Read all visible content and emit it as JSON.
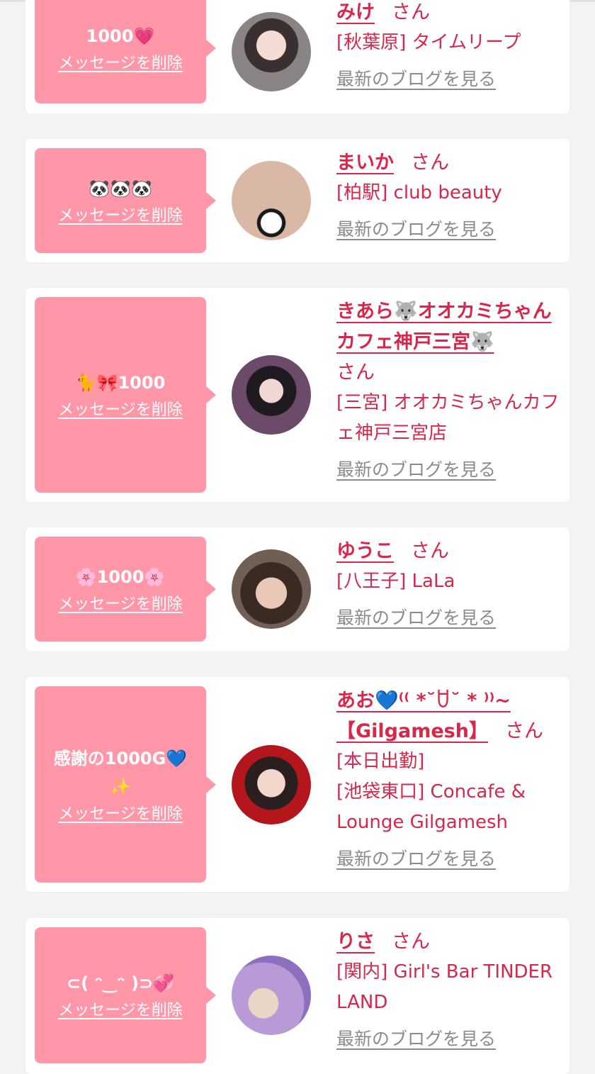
{
  "common": {
    "delete_label": "メッセージを削除",
    "blog_label": "最新のブログを見る",
    "san": "さん"
  },
  "cards": [
    {
      "message": "1000💗",
      "name": "みけ",
      "shop_lines": [
        "[秋葉原] タイムリープ"
      ]
    },
    {
      "message": "🐼🐼🐼",
      "name": "まいか",
      "shop_lines": [
        "[柏駅] club beauty"
      ]
    },
    {
      "message": "🐈🎀1000",
      "name": "きあら🐺オオカミちゃんカフェ神戸三宮🐺",
      "shop_lines": [
        "[三宮] オオカミちゃんカフェ神戸三宮店"
      ]
    },
    {
      "message": "🌸1000🌸",
      "name": "ゆうこ",
      "shop_lines": [
        "[八王子] LaLa"
      ]
    },
    {
      "message": "感謝の1000G💙✨",
      "name": "あお💙⁽⁽ *˘ꇴ˘ * ⁾⁾~【Gilgamesh】",
      "shop_lines": [
        "[本日出勤]",
        "[池袋東口] Concafe & Lounge Gilgamesh"
      ]
    },
    {
      "message": "⊂( ᵔ‿ᵔ )⊃💞",
      "name": "りさ",
      "shop_lines": [
        "[関内] Girl's Bar TINDER LAND"
      ]
    }
  ],
  "colors": {
    "bubble": "#ff97a8",
    "accent": "#d9264b",
    "link_gray": "#8b8b8b",
    "background": "#f3f3f3"
  }
}
